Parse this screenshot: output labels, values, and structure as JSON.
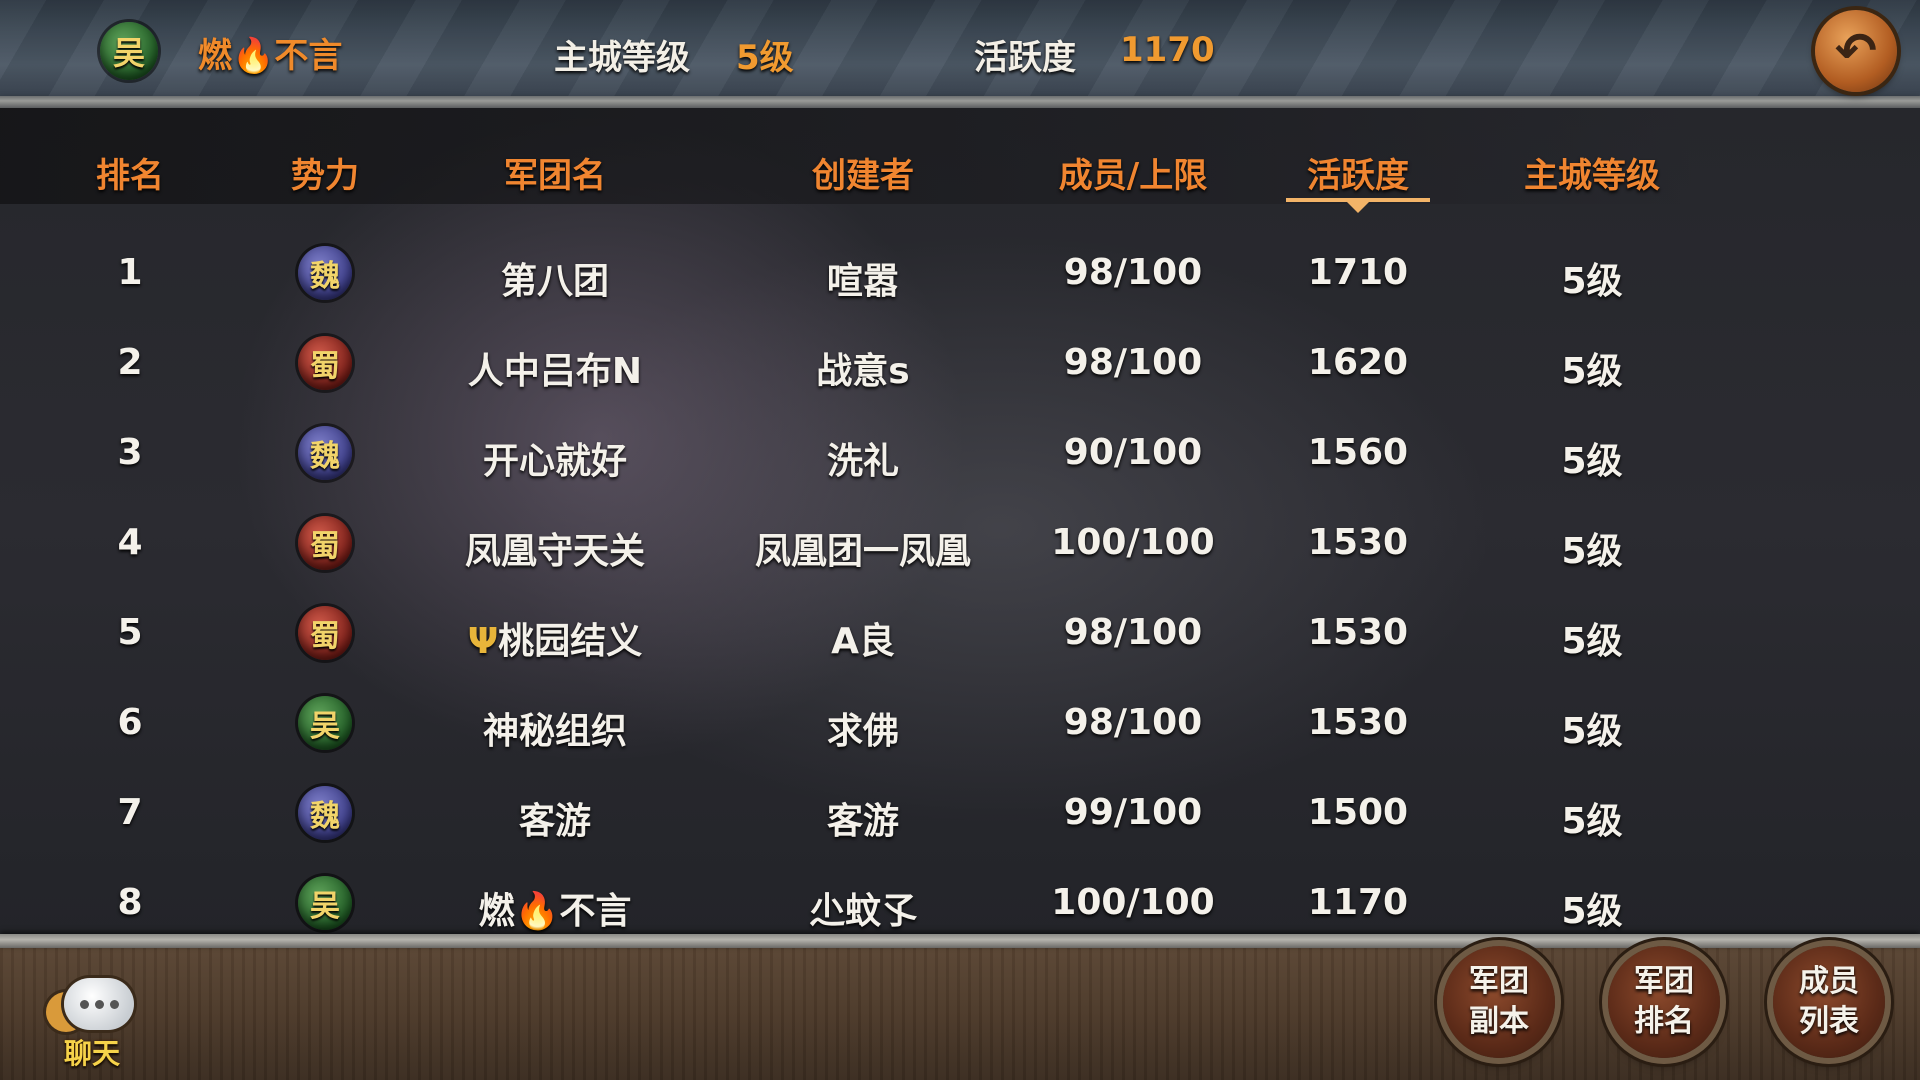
{
  "top_bar": {
    "faction": "吴",
    "player_name_a": "燃",
    "player_name_flame": "🔥",
    "player_name_b": "不言",
    "city_level_label": "主城等级",
    "city_level_value": "5级",
    "activity_label": "活跃度",
    "activity_value": "1170",
    "back_icon": "back-arrow-icon",
    "back_glyph": "↶"
  },
  "table": {
    "headers": [
      "排名",
      "势力",
      "军团名",
      "创建者",
      "成员/上限",
      "活跃度",
      "主城等级"
    ],
    "sorted_by": "活跃度",
    "rows": [
      {
        "rank": "1",
        "faction": "魏",
        "name": "第八团",
        "creator": "喧嚣",
        "members": "98/100",
        "activity": "1710",
        "level": "5级"
      },
      {
        "rank": "2",
        "faction": "蜀",
        "name": "人中吕布N",
        "creator": "战意s",
        "members": "98/100",
        "activity": "1620",
        "level": "5级"
      },
      {
        "rank": "3",
        "faction": "魏",
        "name": "开心就好",
        "creator": "洗礼",
        "members": "90/100",
        "activity": "1560",
        "level": "5级"
      },
      {
        "rank": "4",
        "faction": "蜀",
        "name": "凤凰守天关",
        "creator": "凤凰团一凤凰",
        "members": "100/100",
        "activity": "1530",
        "level": "5级"
      },
      {
        "rank": "5",
        "faction": "蜀",
        "name_icon": "Ψ",
        "name": "桃园结义",
        "creator": "A良",
        "members": "98/100",
        "activity": "1530",
        "level": "5级"
      },
      {
        "rank": "6",
        "faction": "吴",
        "name": "神秘组织",
        "creator": "求佛",
        "members": "98/100",
        "activity": "1530",
        "level": "5级"
      },
      {
        "rank": "7",
        "faction": "魏",
        "name": "客游",
        "creator": "客游",
        "members": "99/100",
        "activity": "1500",
        "level": "5级"
      },
      {
        "rank": "8",
        "faction": "吴",
        "name_a": "燃",
        "name_flame": "🔥",
        "name_b": "不言",
        "creator": "尐蚊孓",
        "members": "100/100",
        "activity": "1170",
        "level": "5级"
      }
    ]
  },
  "bottom_bar": {
    "chat_label": "聊天",
    "buttons": [
      {
        "line1": "军团",
        "line2": "副本"
      },
      {
        "line1": "军团",
        "line2": "排名"
      },
      {
        "line1": "成员",
        "line2": "列表"
      }
    ]
  },
  "colors": {
    "accent_orange": "#f08530",
    "value_orange": "#f09a30",
    "text_white": "#f4f1ea",
    "wu_green": "#1f5a24",
    "wei_blue": "#3a3b86",
    "shu_red": "#7a1e18"
  }
}
